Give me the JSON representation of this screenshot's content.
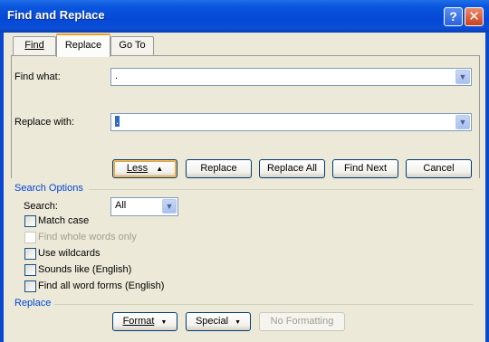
{
  "window": {
    "title": "Find and Replace",
    "help_glyph": "?",
    "close_glyph": "✕"
  },
  "tabs": [
    {
      "label": "Find",
      "active": false
    },
    {
      "label": "Replace",
      "active": true
    },
    {
      "label": "Go To",
      "active": false
    }
  ],
  "find": {
    "label": "Find what:",
    "value": "."
  },
  "replace": {
    "label": "Replace with:",
    "value": "."
  },
  "buttons": {
    "less": "Less",
    "less_arrow": "▲",
    "replace": "Replace",
    "replace_all": "Replace All",
    "find_next": "Find Next",
    "cancel": "Cancel"
  },
  "search_options": {
    "heading": "Search Options",
    "search_label": "Search:",
    "search_value": "All",
    "options": [
      {
        "label": "Match case",
        "checked": false,
        "enabled": true
      },
      {
        "label": "Find whole words only",
        "checked": false,
        "enabled": false
      },
      {
        "label": "Use wildcards",
        "checked": false,
        "enabled": true
      },
      {
        "label": "Sounds like (English)",
        "checked": false,
        "enabled": true
      },
      {
        "label": "Find all word forms (English)",
        "checked": false,
        "enabled": true
      }
    ]
  },
  "replace_section": {
    "heading": "Replace",
    "format_button": "Format",
    "special_button": "Special",
    "no_formatting_button": "No Formatting",
    "dropdown_arrow": "▼"
  }
}
